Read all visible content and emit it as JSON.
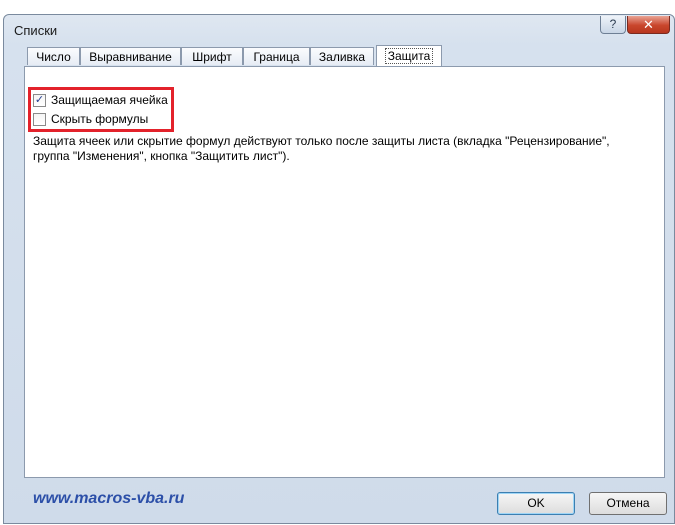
{
  "window": {
    "title": "Списки",
    "help_label": "?",
    "close_label": "✕"
  },
  "tabs": [
    {
      "label": "Число"
    },
    {
      "label": "Выравнивание"
    },
    {
      "label": "Шрифт"
    },
    {
      "label": "Граница"
    },
    {
      "label": "Заливка"
    },
    {
      "label": "Защита",
      "active": true
    }
  ],
  "protection": {
    "locked": {
      "label": "Защищаемая ячейка",
      "checked": true,
      "check_glyph": "✓"
    },
    "hidden": {
      "label": "Скрыть формулы",
      "checked": false
    },
    "description": "Защита ячеек или скрытие формул действуют только после защиты листа (вкладка \"Рецензирование\", группа \"Изменения\", кнопка \"Защитить лист\")."
  },
  "footer": {
    "watermark": "www.macros-vba.ru",
    "ok_label": "OK",
    "cancel_label": "Отмена"
  },
  "colors": {
    "highlight": "#e3222b",
    "watermark": "#2c4fa8",
    "check": "#243d8f"
  }
}
